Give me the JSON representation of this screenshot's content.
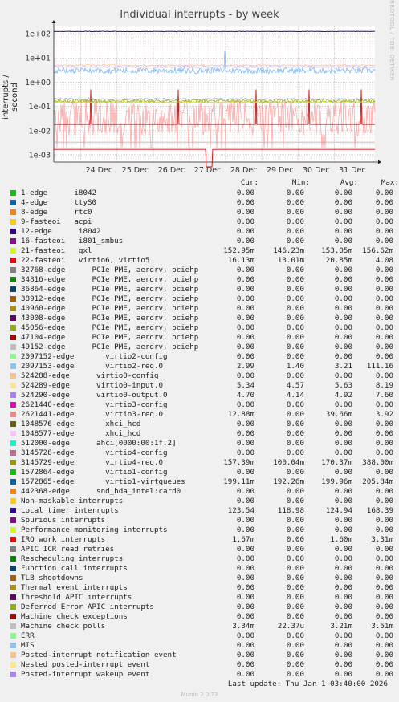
{
  "chart_data": {
    "type": "line",
    "title": "Individual interrupts - by week",
    "ylabel": "interrupts / second",
    "yscale": "log",
    "ylim": [
      0.0005,
      200
    ],
    "yticks": [
      {
        "v": 100,
        "label": "1e+02"
      },
      {
        "v": 10,
        "label": "1e+01"
      },
      {
        "v": 1,
        "label": "1e+00"
      },
      {
        "v": 0.1,
        "label": "1e-01"
      },
      {
        "v": 0.01,
        "label": "1e-02"
      },
      {
        "v": 0.001,
        "label": "1e-03"
      }
    ],
    "xlim": [
      "2025-12-23 06:00",
      "2026-01-01 03:00"
    ],
    "xticks": [
      "24 Dec",
      "25 Dec",
      "26 Dec",
      "27 Dec",
      "28 Dec",
      "29 Dec",
      "30 Dec",
      "31 Dec"
    ],
    "grid": true,
    "series_levels": [
      {
        "name": "Local timer interrupts",
        "color": "#330099",
        "value": 123.54
      },
      {
        "name": "2621440-edge",
        "color": "#aa0000",
        "value": 0.06
      },
      {
        "name": "virtio rates",
        "color": "#ff9999",
        "value": 5.0
      },
      {
        "name": "virtio2-req.0",
        "color": "#55aaff",
        "value": 2.99
      },
      {
        "name": "21-fasteoi",
        "color": "#ccff00",
        "value": 0.15
      },
      {
        "name": "Machine check polls",
        "color": "#999999",
        "value": 0.00334
      },
      {
        "name": "IRQ work interrupts",
        "color": "#dd0000",
        "value": 0.00167
      }
    ]
  },
  "legend": {
    "headers": {
      "cur": "Cur:",
      "min": "Min:",
      "avg": "Avg:",
      "max": "Max:"
    },
    "rows": [
      {
        "label": "1-edge      i8042",
        "color": "#00cc00",
        "cur": "0.00",
        "min": "0.00",
        "avg": "0.00",
        "max": "0.00"
      },
      {
        "label": "4-edge      ttyS0",
        "color": "#0066b3",
        "cur": "0.00",
        "min": "0.00",
        "avg": "0.00",
        "max": "0.00"
      },
      {
        "label": "8-edge      rtc0",
        "color": "#ff8000",
        "cur": "0.00",
        "min": "0.00",
        "avg": "0.00",
        "max": "0.00"
      },
      {
        "label": "9-fasteoi   acpi",
        "color": "#ffcc00",
        "cur": "0.00",
        "min": "0.00",
        "avg": "0.00",
        "max": "0.00"
      },
      {
        "label": "12-edge      i8042",
        "color": "#330099",
        "cur": "0.00",
        "min": "0.00",
        "avg": "0.00",
        "max": "0.00"
      },
      {
        "label": "16-fasteoi   i801_smbus",
        "color": "#990099",
        "cur": "0.00",
        "min": "0.00",
        "avg": "0.00",
        "max": "0.00"
      },
      {
        "label": "21-fasteoi   qxl",
        "color": "#ccff00",
        "cur": "152.95m",
        "min": "146.23m",
        "avg": "153.05m",
        "max": "156.62m"
      },
      {
        "label": "22-fasteoi   virtio6, virtio5",
        "color": "#ff0000",
        "cur": "16.13m",
        "min": "13.01m",
        "avg": "20.85m",
        "max": "4.08"
      },
      {
        "label": "32768-edge      PCIe PME, aerdrv, pciehp",
        "color": "#808080",
        "cur": "0.00",
        "min": "0.00",
        "avg": "0.00",
        "max": "0.00"
      },
      {
        "label": "34816-edge      PCIe PME, aerdrv, pciehp",
        "color": "#008f00",
        "cur": "0.00",
        "min": "0.00",
        "avg": "0.00",
        "max": "0.00"
      },
      {
        "label": "36864-edge      PCIe PME, aerdrv, pciehp",
        "color": "#00487d",
        "cur": "0.00",
        "min": "0.00",
        "avg": "0.00",
        "max": "0.00"
      },
      {
        "label": "38912-edge      PCIe PME, aerdrv, pciehp",
        "color": "#b35a00",
        "cur": "0.00",
        "min": "0.00",
        "avg": "0.00",
        "max": "0.00"
      },
      {
        "label": "40960-edge      PCIe PME, aerdrv, pciehp",
        "color": "#b38f00",
        "cur": "0.00",
        "min": "0.00",
        "avg": "0.00",
        "max": "0.00"
      },
      {
        "label": "43008-edge      PCIe PME, aerdrv, pciehp",
        "color": "#6b006b",
        "cur": "0.00",
        "min": "0.00",
        "avg": "0.00",
        "max": "0.00"
      },
      {
        "label": "45056-edge      PCIe PME, aerdrv, pciehp",
        "color": "#8fb300",
        "cur": "0.00",
        "min": "0.00",
        "avg": "0.00",
        "max": "0.00"
      },
      {
        "label": "47104-edge      PCIe PME, aerdrv, pciehp",
        "color": "#b30000",
        "cur": "0.00",
        "min": "0.00",
        "avg": "0.00",
        "max": "0.00"
      },
      {
        "label": "49152-edge      PCIe PME, aerdrv, pciehp",
        "color": "#bebebe",
        "cur": "0.00",
        "min": "0.00",
        "avg": "0.00",
        "max": "0.00"
      },
      {
        "label": "2097152-edge       virtio2-config",
        "color": "#80ff80",
        "cur": "0.00",
        "min": "0.00",
        "avg": "0.00",
        "max": "0.00"
      },
      {
        "label": "2097153-edge       virtio2-req.0",
        "color": "#80c9ff",
        "cur": "2.99",
        "min": "1.40",
        "avg": "3.21",
        "max": "111.16"
      },
      {
        "label": "524288-edge      virtio0-config",
        "color": "#ffc080",
        "cur": "0.00",
        "min": "0.00",
        "avg": "0.00",
        "max": "0.00"
      },
      {
        "label": "524289-edge      virtio0-input.0",
        "color": "#ffe680",
        "cur": "5.34",
        "min": "4.57",
        "avg": "5.63",
        "max": "8.19"
      },
      {
        "label": "524290-edge      virtio0-output.0",
        "color": "#aa80ff",
        "cur": "4.70",
        "min": "4.14",
        "avg": "4.92",
        "max": "7.60"
      },
      {
        "label": "2621440-edge       virtio3-config",
        "color": "#ee00cc",
        "cur": "0.00",
        "min": "0.00",
        "avg": "0.00",
        "max": "0.00"
      },
      {
        "label": "2621441-edge       virtio3-req.0",
        "color": "#ff8080",
        "cur": "12.88m",
        "min": "0.00",
        "avg": "39.66m",
        "max": "3.92"
      },
      {
        "label": "1048576-edge       xhci_hcd",
        "color": "#666600",
        "cur": "0.00",
        "min": "0.00",
        "avg": "0.00",
        "max": "0.00"
      },
      {
        "label": "1048577-edge       xhci_hcd",
        "color": "#ffbfff",
        "cur": "0.00",
        "min": "0.00",
        "avg": "0.00",
        "max": "0.00"
      },
      {
        "label": "512000-edge      ahci[0000:00:1f.2]",
        "color": "#00ffcc",
        "cur": "0.00",
        "min": "0.00",
        "avg": "0.00",
        "max": "0.00"
      },
      {
        "label": "3145728-edge       virtio4-config",
        "color": "#cc6699",
        "cur": "0.00",
        "min": "0.00",
        "avg": "0.00",
        "max": "0.00"
      },
      {
        "label": "3145729-edge       virtio4-req.0",
        "color": "#999900",
        "cur": "157.39m",
        "min": "100.04m",
        "avg": "170.37m",
        "max": "388.00m"
      },
      {
        "label": "1572864-edge       virtio1-config",
        "color": "#00cc00",
        "cur": "0.00",
        "min": "0.00",
        "avg": "0.00",
        "max": "0.00"
      },
      {
        "label": "1572865-edge       virtio1-virtqueues",
        "color": "#0066b3",
        "cur": "199.11m",
        "min": "192.26m",
        "avg": "199.96m",
        "max": "205.84m"
      },
      {
        "label": "442368-edge      snd_hda_intel:card0",
        "color": "#ff8000",
        "cur": "0.00",
        "min": "0.00",
        "avg": "0.00",
        "max": "0.00"
      },
      {
        "label": "Non-maskable interrupts",
        "color": "#ffcc00",
        "cur": "0.00",
        "min": "0.00",
        "avg": "0.00",
        "max": "0.00"
      },
      {
        "label": "Local timer interrupts",
        "color": "#330099",
        "cur": "123.54",
        "min": "118.98",
        "avg": "124.94",
        "max": "168.39"
      },
      {
        "label": "Spurious interrupts",
        "color": "#990099",
        "cur": "0.00",
        "min": "0.00",
        "avg": "0.00",
        "max": "0.00"
      },
      {
        "label": "Performance monitoring interrupts",
        "color": "#ccff00",
        "cur": "0.00",
        "min": "0.00",
        "avg": "0.00",
        "max": "0.00"
      },
      {
        "label": "IRQ work interrupts",
        "color": "#ff0000",
        "cur": "1.67m",
        "min": "0.00",
        "avg": "1.60m",
        "max": "3.31m"
      },
      {
        "label": "APIC ICR read retries",
        "color": "#808080",
        "cur": "0.00",
        "min": "0.00",
        "avg": "0.00",
        "max": "0.00"
      },
      {
        "label": "Rescheduling interrupts",
        "color": "#008f00",
        "cur": "0.00",
        "min": "0.00",
        "avg": "0.00",
        "max": "0.00"
      },
      {
        "label": "Function call interrupts",
        "color": "#00487d",
        "cur": "0.00",
        "min": "0.00",
        "avg": "0.00",
        "max": "0.00"
      },
      {
        "label": "TLB shootdowns",
        "color": "#b35a00",
        "cur": "0.00",
        "min": "0.00",
        "avg": "0.00",
        "max": "0.00"
      },
      {
        "label": "Thermal event interrupts",
        "color": "#b38f00",
        "cur": "0.00",
        "min": "0.00",
        "avg": "0.00",
        "max": "0.00"
      },
      {
        "label": "Threshold APIC interrupts",
        "color": "#6b006b",
        "cur": "0.00",
        "min": "0.00",
        "avg": "0.00",
        "max": "0.00"
      },
      {
        "label": "Deferred Error APIC interrupts",
        "color": "#8fb300",
        "cur": "0.00",
        "min": "0.00",
        "avg": "0.00",
        "max": "0.00"
      },
      {
        "label": "Machine check exceptions",
        "color": "#b30000",
        "cur": "0.00",
        "min": "0.00",
        "avg": "0.00",
        "max": "0.00"
      },
      {
        "label": "Machine check polls",
        "color": "#bebebe",
        "cur": "3.34m",
        "min": "22.37u",
        "avg": "3.21m",
        "max": "3.51m"
      },
      {
        "label": "ERR",
        "color": "#80ff80",
        "cur": "0.00",
        "min": "0.00",
        "avg": "0.00",
        "max": "0.00"
      },
      {
        "label": "MIS",
        "color": "#80c9ff",
        "cur": "0.00",
        "min": "0.00",
        "avg": "0.00",
        "max": "0.00"
      },
      {
        "label": "Posted-interrupt notification event",
        "color": "#ffc080",
        "cur": "0.00",
        "min": "0.00",
        "avg": "0.00",
        "max": "0.00"
      },
      {
        "label": "Nested posted-interrupt event",
        "color": "#ffe680",
        "cur": "0.00",
        "min": "0.00",
        "avg": "0.00",
        "max": "0.00"
      },
      {
        "label": "Posted-interrupt wakeup event",
        "color": "#aa80ff",
        "cur": "0.00",
        "min": "0.00",
        "avg": "0.00",
        "max": "0.00"
      }
    ]
  },
  "footer": "Last update: Thu Jan  1 03:40:00 2026",
  "version": "Munin 2.0.73",
  "side_label": "RRDTOOL / TOBI OETIKER"
}
